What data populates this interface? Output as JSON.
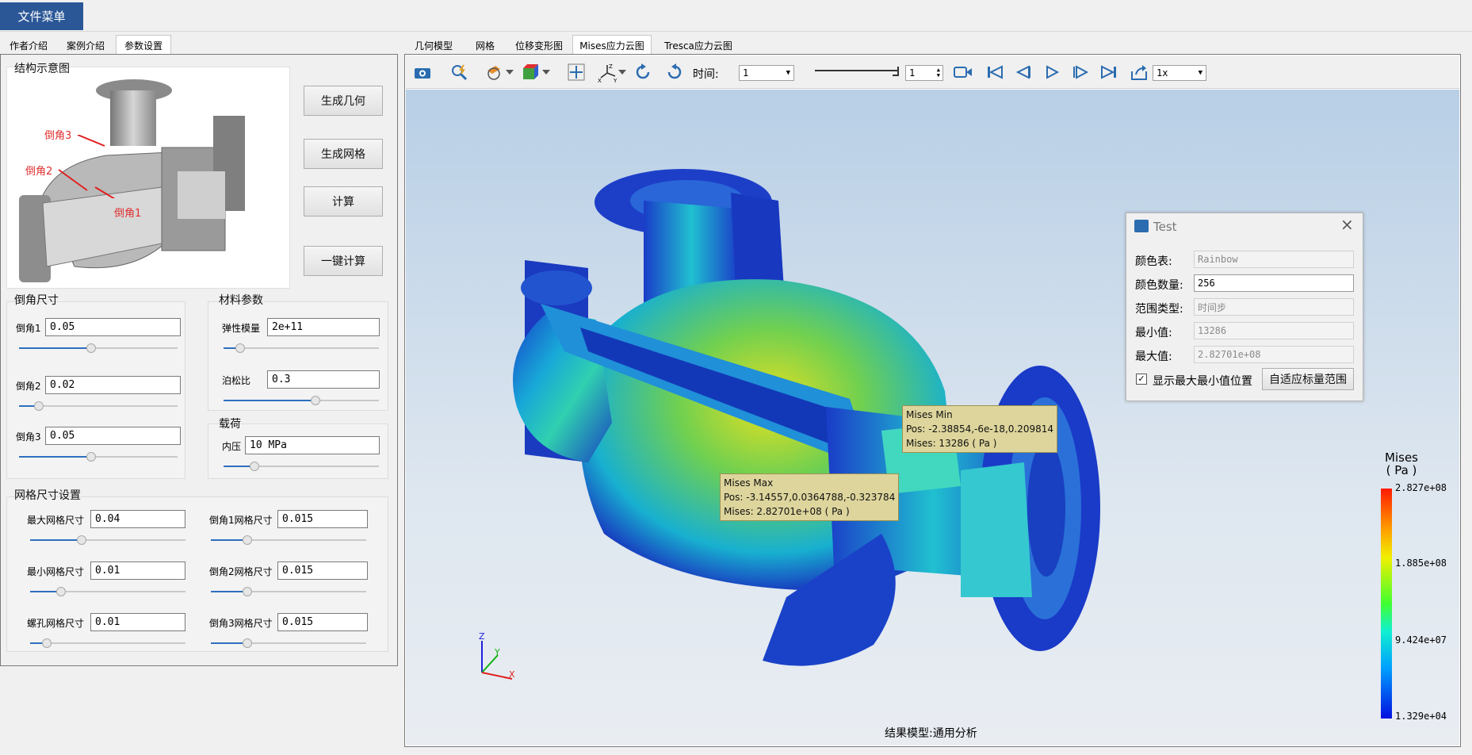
{
  "menu": {
    "file": "文件菜单"
  },
  "left_tabs": [
    "作者介绍",
    "案例介绍",
    "参数设置"
  ],
  "schematic": {
    "title": "结构示意图",
    "callouts": [
      "倒角3",
      "倒角2",
      "倒角1"
    ]
  },
  "actions": [
    "生成几何",
    "生成网格",
    "计算",
    "一键计算"
  ],
  "chamfer": {
    "title": "倒角尺寸",
    "fields": [
      {
        "label": "倒角1",
        "value": "0.05",
        "pos": 0.45
      },
      {
        "label": "倒角2",
        "value": "0.02",
        "pos": 0.1
      },
      {
        "label": "倒角3",
        "value": "0.05",
        "pos": 0.45
      }
    ]
  },
  "material": {
    "title": "材料参数",
    "fields": [
      {
        "label": "弹性模量",
        "value": "2e+11",
        "pos": 0.08
      },
      {
        "label": "泊松比",
        "value": "0.3",
        "pos": 0.6
      }
    ]
  },
  "load": {
    "title": "载荷",
    "fields": [
      {
        "label": "内压",
        "value": "10 MPa",
        "pos": 0.18
      }
    ]
  },
  "mesh": {
    "title": "网格尺寸设置",
    "fields": [
      {
        "label": "最大网格尺寸",
        "value": "0.04",
        "pos": 0.32
      },
      {
        "label": "倒角1网格尺寸",
        "value": "0.015",
        "pos": 0.22
      },
      {
        "label": "最小网格尺寸",
        "value": "0.01",
        "pos": 0.18
      },
      {
        "label": "倒角2网格尺寸",
        "value": "0.015",
        "pos": 0.22
      },
      {
        "label": "螺孔网格尺寸",
        "value": "0.01",
        "pos": 0.08
      },
      {
        "label": "倒角3网格尺寸",
        "value": "0.015",
        "pos": 0.22
      }
    ]
  },
  "right_tabs": [
    "几何模型",
    "网格",
    "位移变形图",
    "Mises应力云图",
    "Tresca应力云图"
  ],
  "toolbar": {
    "time_label": "时间:",
    "time_value": "1",
    "step_value": "1",
    "speed_value": "1x"
  },
  "tooltips": {
    "max": [
      "Mises Max",
      "Pos: -3.14557,0.0364788,-0.323784",
      "Mises: 2.82701e+08 ( Pa )"
    ],
    "min": [
      "Mises Min",
      "Pos: -2.38854,-6e-18,0.209814",
      "Mises: 13286 ( Pa )"
    ]
  },
  "legend": {
    "title": "Mises",
    "unit": "( Pa )",
    "ticks": [
      "2.827e+08",
      "1.885e+08",
      "9.424e+07",
      "1.329e+04"
    ]
  },
  "axes": {
    "x": "X",
    "y": "Y",
    "z": "Z"
  },
  "footer": "结果模型:通用分析",
  "dialog": {
    "title": "Test",
    "rows": [
      {
        "label": "颜色表:",
        "value": "Rainbow"
      },
      {
        "label": "颜色数量:",
        "value": "256"
      },
      {
        "label": "范围类型:",
        "value": "时间步"
      },
      {
        "label": "最小值:",
        "value": "13286"
      },
      {
        "label": "最大值:",
        "value": "2.82701e+08"
      }
    ],
    "checkbox": "显示最大最小值位置",
    "button": "自适应标量范围"
  },
  "colors": {
    "accent": "#2b5797",
    "slider": "#2e6fbf"
  }
}
